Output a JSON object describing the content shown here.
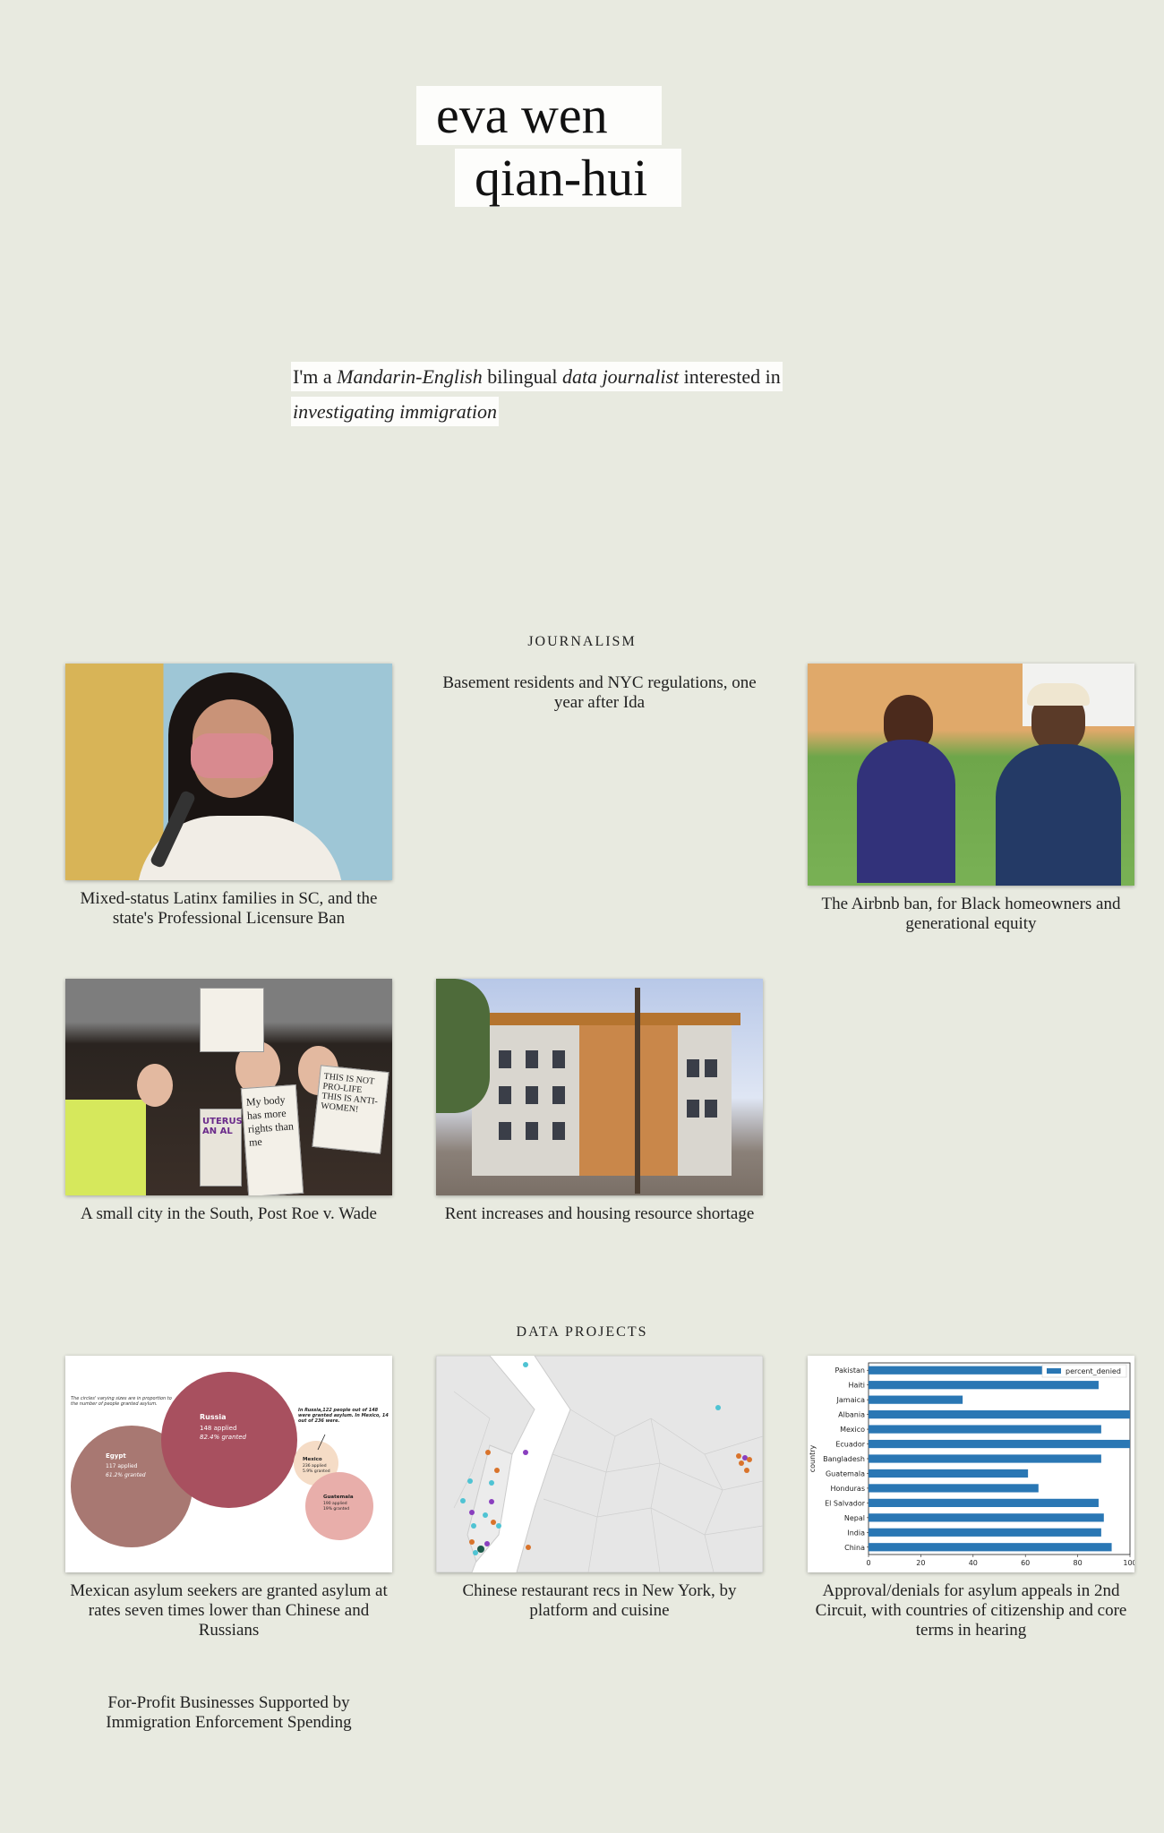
{
  "header": {
    "name_line1": "eva wen",
    "name_line2": "qian-hui"
  },
  "intro": {
    "part1": "I'm a ",
    "em1": "Mandarin-English",
    "part2": " bilingual ",
    "em2": "data journalist",
    "part3": " interested in",
    "em3": "investigating immigration"
  },
  "journalism": {
    "title": "JOURNALISM",
    "items": [
      {
        "caption": "Mixed-status Latinx families in SC, and the state's Professional Licensure Ban"
      },
      {
        "caption": "Basement residents and NYC regulations, one year after Ida"
      },
      {
        "caption": "The Airbnb ban, for Black homeowners and generational equity"
      },
      {
        "caption": "A small city in the South, Post Roe v. Wade"
      },
      {
        "caption": "Rent increases and housing resource shortage"
      }
    ],
    "sign_texts": [
      "My body has more rights than me",
      "THIS IS NOT PRO-LIFE THIS IS ANTI-WOMEN!",
      "UTERUS AN AL"
    ]
  },
  "data_projects": {
    "title": "DATA PROJECTS",
    "items": [
      {
        "caption": "Mexican asylum seekers are granted asylum at rates seven times lower than Chinese and Russians"
      },
      {
        "caption": "Chinese restaurant recs in New York, by platform and cuisine"
      },
      {
        "caption": "Approval/denials for asylum appeals in 2nd Circuit, with countries of citizenship and core terms in hearing"
      },
      {
        "caption": "For-Profit Businesses Supported by Immigration Enforcement Spending"
      }
    ]
  },
  "bubble_chart": {
    "note": "The circles' varying sizes are in proportion to the number of people granted asylum.",
    "annotation": "In Russia,122 people out of 148 were granted asylum. In Mexico, 14 out of 236 were.",
    "bubbles": [
      {
        "country": "Russia",
        "applied": "148 applied",
        "granted": "82.4% granted",
        "color": "#a8505f"
      },
      {
        "country": "Egypt",
        "applied": "117 applied",
        "granted": "61.2% granted",
        "color": "#a87872"
      },
      {
        "country": "Mexico",
        "applied": "236 applied",
        "granted": "5.9% granted",
        "color": "#f5dcc6"
      },
      {
        "country": "Guatemala",
        "applied": "190 applied",
        "granted": "19% granted",
        "color": "#e8aeaa"
      }
    ]
  },
  "chart_data": {
    "type": "bar",
    "orientation": "horizontal",
    "ylabel": "country",
    "xlim": [
      0,
      100
    ],
    "xticks": [
      "0",
      "20",
      "40",
      "60",
      "80",
      "100"
    ],
    "legend": "percent_denied",
    "legend_position": "top-right",
    "color": "#2a77b4",
    "categories": [
      "Pakistan",
      "Haiti",
      "Jamaica",
      "Albania",
      "Mexico",
      "Ecuador",
      "Bangladesh",
      "Guatemala",
      "Honduras",
      "El Salvador",
      "Nepal",
      "India",
      "China"
    ],
    "values": [
      70,
      88,
      36,
      100,
      89,
      100,
      89,
      61,
      65,
      88,
      90,
      89,
      93
    ]
  }
}
